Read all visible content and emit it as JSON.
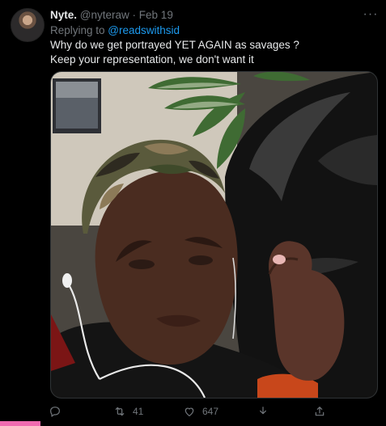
{
  "tweet": {
    "display_name": "Nyte.",
    "handle": "@nyteraw",
    "separator": "·",
    "date": "Feb 19",
    "replying_prefix": "Replying to ",
    "replying_to": "@readswithsid",
    "text_line1": "Why do we get portrayed YET AGAIN as savages ?",
    "text_line2": "Keep your representation, we don't want it",
    "more_label": "···"
  },
  "actions": {
    "reply_icon": "reply-icon",
    "retweet_icon": "retweet-icon",
    "retweet_count": "41",
    "like_icon": "heart-icon",
    "like_count": "647",
    "download_icon": "download-icon",
    "share_icon": "share-icon"
  },
  "colors": {
    "background": "#000000",
    "text": "#e7e9ea",
    "muted": "#71767b",
    "link": "#1d9bf0"
  }
}
